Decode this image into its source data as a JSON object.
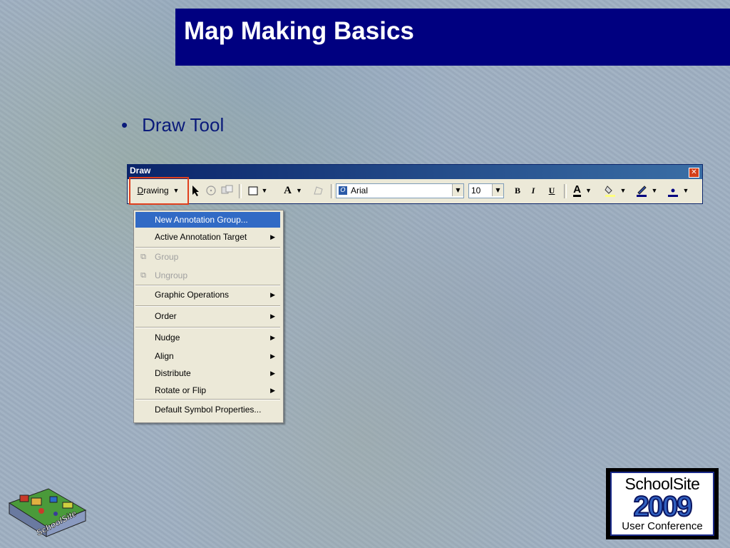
{
  "slide": {
    "title": "Map Making Basics",
    "bullet_marker": "•",
    "bullet_text": "Draw Tool"
  },
  "draw_window": {
    "title": "Draw",
    "close_icon": "close-icon",
    "toolbar": {
      "drawing_menu_label_prefix": "D",
      "drawing_menu_label_rest": "rawing",
      "drawing_menu_arrow": "▼",
      "font_name": "Arial",
      "font_size": "10",
      "bold": "B",
      "italic": "I",
      "underline": "U",
      "font_color_letter": "A",
      "text_tool_letter": "A"
    }
  },
  "context_menu": {
    "items": [
      {
        "label": "New Annotation Group...",
        "state": "selected",
        "submenu": false
      },
      {
        "label": "Active Annotation Target",
        "state": "normal",
        "submenu": true
      },
      {
        "label": "Group",
        "state": "disabled",
        "submenu": false
      },
      {
        "label": "Ungroup",
        "state": "disabled",
        "submenu": false
      },
      {
        "label": "Graphic Operations",
        "state": "normal",
        "submenu": true
      },
      {
        "label": "Order",
        "state": "normal",
        "submenu": true
      },
      {
        "label": "Nudge",
        "state": "normal",
        "submenu": true
      },
      {
        "label": "Align",
        "state": "normal",
        "submenu": true
      },
      {
        "label": "Distribute",
        "state": "normal",
        "submenu": true
      },
      {
        "label": "Rotate or Flip",
        "state": "normal",
        "submenu": true
      },
      {
        "label": "Default Symbol Properties...",
        "state": "normal",
        "submenu": false
      }
    ]
  },
  "logos": {
    "left_text": "SchoolSite",
    "right_top": "SchoolSite",
    "right_year": "2009",
    "right_bottom": "User Conference"
  },
  "colors": {
    "title_bg": "#000080",
    "bullet_text": "#0a1a7a",
    "highlight_box": "#e0401e",
    "menu_selected": "#316ac5"
  }
}
